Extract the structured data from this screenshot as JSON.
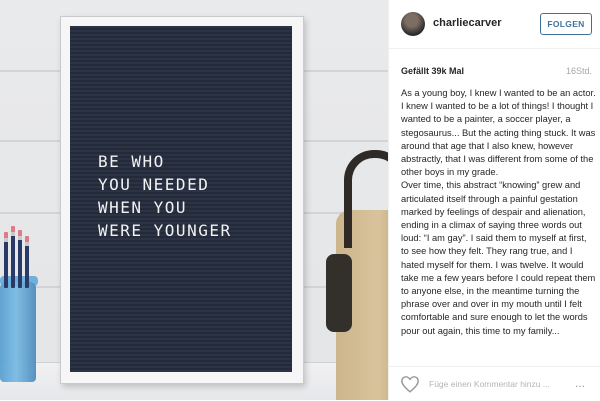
{
  "photo": {
    "letter_board_text": "BE WHO\nYOU NEEDED\nWHEN YOU\nWERE YOUNGER"
  },
  "header": {
    "username": "charliecarver",
    "follow_label": "FOLGEN"
  },
  "stats": {
    "likes_text": "Gefällt 39k Mal",
    "time_text": "16Std."
  },
  "caption": {
    "paragraph1": "As a young boy, I knew I wanted to be an actor. I knew I wanted to be a lot of things! I thought I wanted to be a painter, a soccer player, a stegosaurus... But the acting thing stuck. It was around that age that I also knew, however abstractly, that I was different from some of the other boys in my grade.",
    "paragraph2": "Over time, this abstract “knowing” grew and articulated itself through a painful gestation marked by feelings of despair and alienation, ending in a climax of saying three words out loud: “I am gay”. I said them to myself at first, to see how they felt. They rang true, and I hated myself for them. I was twelve. It would take me a few years before I could repeat them to anyone else, in the meantime turning the phrase over and over in my mouth until I felt comfortable and sure enough to let the words pour out again, this time to my family..."
  },
  "footer": {
    "comment_placeholder": "Füge einen Kommentar hinzu ...",
    "more_label": "..."
  },
  "colors": {
    "accent": "#3f729b",
    "text": "#262626",
    "muted": "#a5a7aa",
    "board": "#2a3142"
  },
  "icons": {
    "like": "heart-icon",
    "more": "more-options-icon"
  }
}
